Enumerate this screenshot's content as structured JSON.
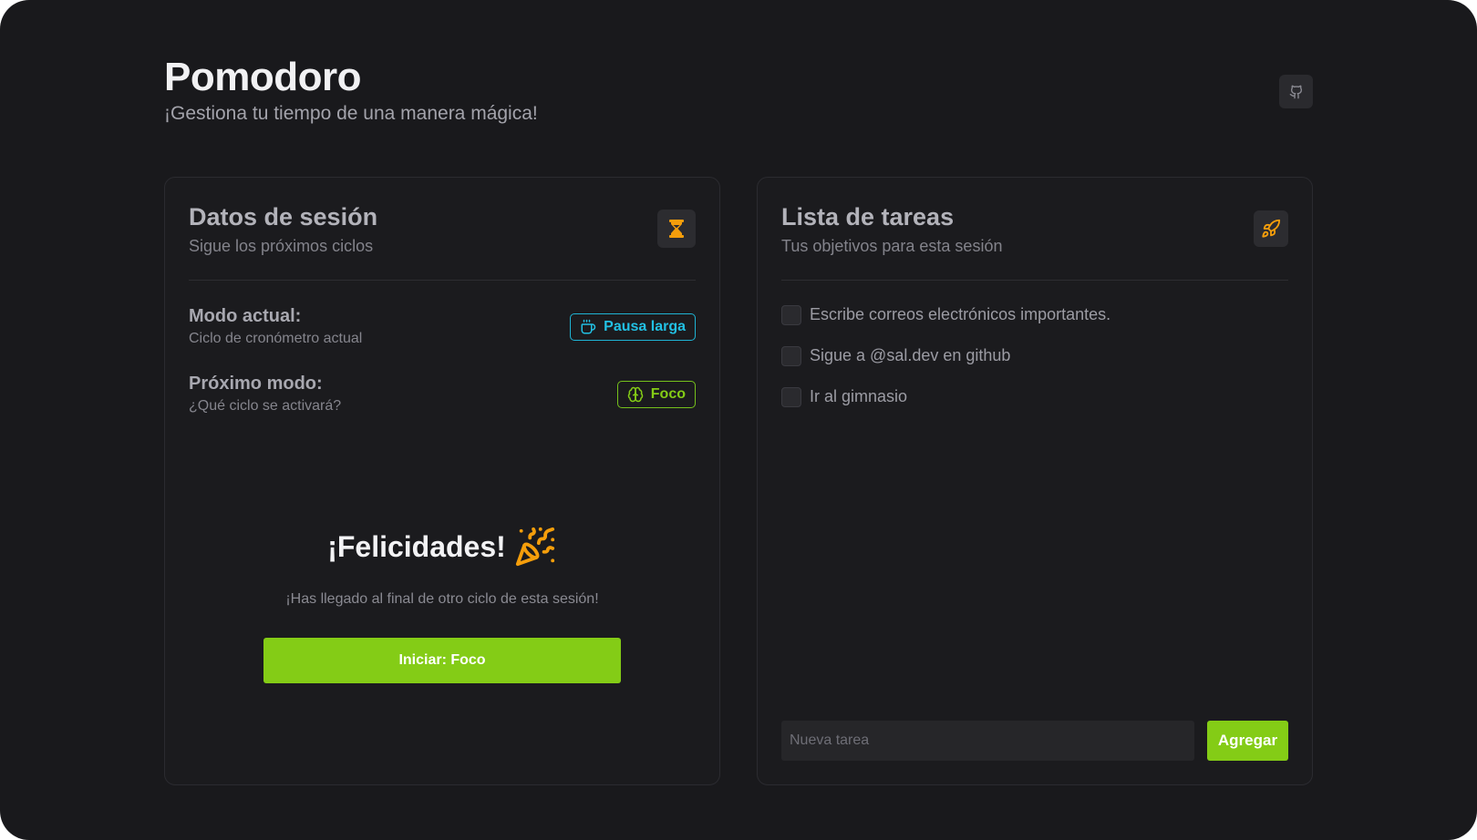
{
  "app": {
    "title": "Pomodoro",
    "subtitle": "¡Gestiona tu tiempo de una manera mágica!",
    "github_icon": "github-icon"
  },
  "session": {
    "title": "Datos de sesión",
    "subtitle": "Sigue los próximos ciclos",
    "icon": "hourglass-icon",
    "current_mode": {
      "label": "Modo actual:",
      "sub": "Ciclo de cronómetro actual",
      "badge": "Pausa larga",
      "badge_icon": "coffee-icon",
      "badge_color": "#22c0e3"
    },
    "next_mode": {
      "label": "Próximo modo:",
      "sub": "¿Qué ciclo se activará?",
      "badge": "Foco",
      "badge_icon": "brain-icon",
      "badge_color": "#84cc16"
    },
    "congrats": {
      "title": "¡Felicidades!",
      "icon": "party-popper-icon",
      "message": "¡Has llegado al final de otro ciclo de esta sesión!"
    },
    "start_button": "Iniciar: Foco"
  },
  "tasks": {
    "title": "Lista de tareas",
    "subtitle": "Tus objetivos para esta sesión",
    "icon": "rocket-icon",
    "items": [
      {
        "label": "Escribe correos electrónicos importantes.",
        "checked": false
      },
      {
        "label": "Sigue a @sal.dev en github",
        "checked": false
      },
      {
        "label": "Ir al gimnasio",
        "checked": false
      }
    ],
    "new_task_placeholder": "Nueva tarea",
    "new_task_value": "",
    "add_button": "Agregar"
  },
  "colors": {
    "accent": "#84cc16",
    "cyan": "#22c0e3",
    "icon_orange": "#f59e0b",
    "background": "#19191c"
  }
}
